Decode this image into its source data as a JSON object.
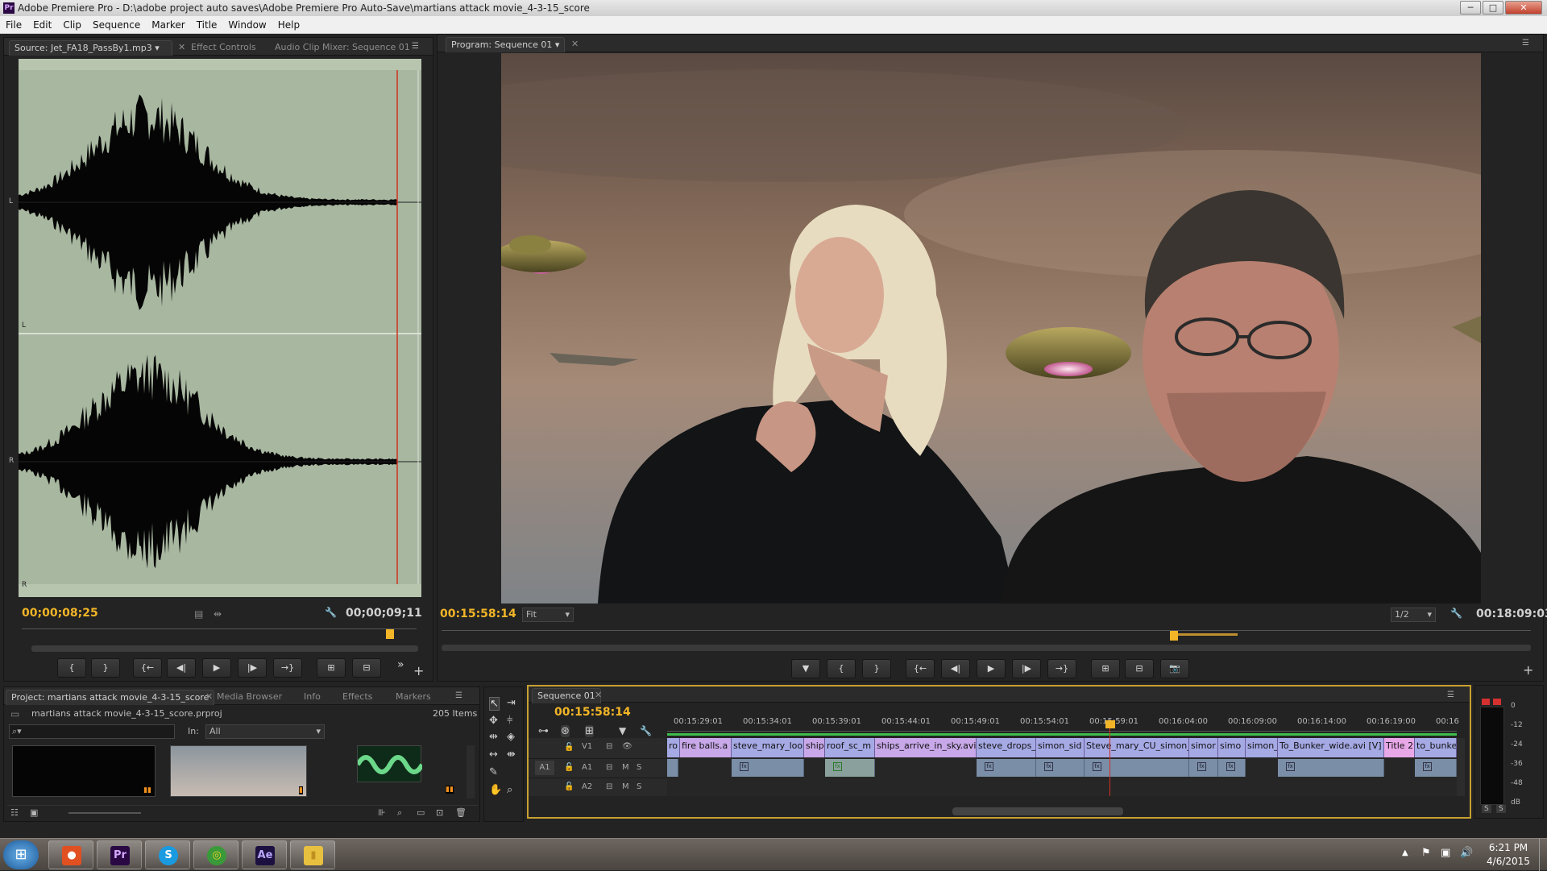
{
  "window": {
    "app_icon": "Pr",
    "title": "Adobe Premiere Pro - D:\\adobe project auto saves\\Adobe Premiere Pro Auto-Save\\martians attack movie_4-3-15_score",
    "minimize": "─",
    "maximize": "□",
    "close": "✕"
  },
  "menu": [
    "File",
    "Edit",
    "Clip",
    "Sequence",
    "Marker",
    "Title",
    "Window",
    "Help"
  ],
  "source_panel": {
    "tabs": [
      "Source: Jet_FA18_PassBy1.mp3",
      "Effect Controls",
      "Audio Clip Mixer: Sequence 01"
    ],
    "channel_labels": [
      "L",
      "L",
      "R",
      "R"
    ],
    "timecode_current": "00;00;08;25",
    "timecode_duration": "00;00;09;11",
    "wave_color": "#a8b7a0"
  },
  "program_panel": {
    "tab": "Program: Sequence 01",
    "timecode_current": "00:15:58:14",
    "fit_label": "Fit",
    "resolution_label": "1/2",
    "timecode_duration": "00:18:09:03"
  },
  "transport_glyphs": {
    "marker": "▼",
    "in": "{",
    "out": "}",
    "go_in": "{←",
    "step_back": "◀|",
    "play": "▶",
    "step_fwd": "|▶",
    "go_out": "→}",
    "insert": "⊞",
    "overwrite": "⊟",
    "export": "📷",
    "more": "»",
    "add": "+"
  },
  "project_panel": {
    "tabs": [
      "Project: martians attack movie_4-3-15_score",
      "Media Browser",
      "Info",
      "Effects",
      "Markers"
    ],
    "project_file": "martians attack movie_4-3-15_score.prproj",
    "items_count": "205 Items",
    "search_placeholder": "",
    "in_label": "In:",
    "in_value": "All"
  },
  "timeline": {
    "tab": "Sequence 01",
    "timecode": "00:15:58:14",
    "ruler": [
      "00:15:29:01",
      "00:15:34:01",
      "00:15:39:01",
      "00:15:44:01",
      "00:15:49:01",
      "00:15:54:01",
      "00:15:59:01",
      "00:16:04:00",
      "00:16:09:00",
      "00:16:14:00",
      "00:16:19:00",
      "00:16"
    ],
    "tracks": {
      "v1": "V1",
      "a1_source": "A1",
      "a1": "A1",
      "a2": "A2",
      "mute": "M",
      "solo": "S"
    },
    "video_clips": [
      "ro",
      "fire balls.a",
      "steve_mary_look",
      "ship",
      "roof_sc_m",
      "ships_arrive_in_sky.avi",
      "steve_drops_",
      "simon_sid",
      "Steve_mary_CU_simon_c",
      "simor",
      "simo",
      "simon_",
      "To_Bunker_wide.avi [V]",
      "Title 2",
      "to_bunke"
    ],
    "fx_badge": "fx"
  },
  "meter": {
    "scale": [
      "0",
      "-12",
      "-24",
      "-36",
      "-48",
      "dB"
    ],
    "solo_buttons": [
      "S",
      "S"
    ]
  },
  "taskbar": {
    "start": "⊞",
    "apps": [
      {
        "name": "maps",
        "glyph": "●",
        "color": "#e05020"
      },
      {
        "name": "premiere",
        "glyph": "Pr",
        "color": "#2a0844"
      },
      {
        "name": "skype",
        "glyph": "S",
        "color": "#1a9ae0"
      },
      {
        "name": "chrome",
        "glyph": "◎",
        "color": "#3a9a3a"
      },
      {
        "name": "after-effects",
        "glyph": "Ae",
        "color": "#1c1040"
      },
      {
        "name": "explorer",
        "glyph": "▮",
        "color": "#e8c040"
      }
    ],
    "time": "6:21 PM",
    "date": "4/6/2015"
  }
}
